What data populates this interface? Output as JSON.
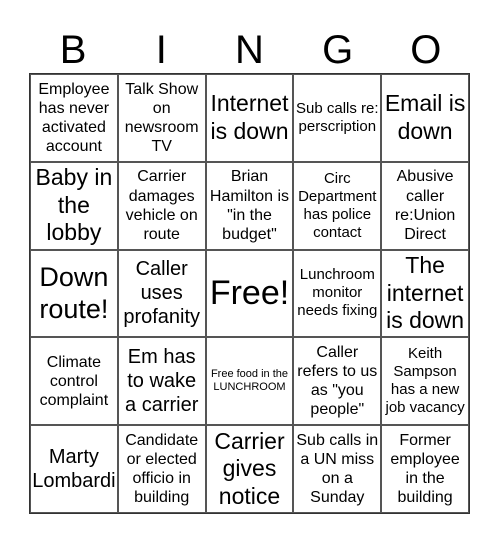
{
  "header": [
    "B",
    "I",
    "N",
    "G",
    "O"
  ],
  "cells": [
    "Employee has never activated account",
    "Talk Show on newsroom TV",
    "Internet is down",
    "Sub calls re: perscription",
    "Email is down",
    "Baby in the lobby",
    "Carrier damages vehicle on route",
    "Brian Hamilton is \"in the budget\"",
    "Circ Department has police contact",
    "Abusive caller re:Union Direct",
    "Down route!",
    "Caller uses profanity",
    "Free!",
    "Lunchroom monitor needs fixing",
    "The internet is down",
    "Climate control complaint",
    "Em has to wake a carrier",
    "Free food in the LUNCHROOM",
    "Caller refers to us as \"you people\"",
    "Keith Sampson has a new job vacancy",
    "Marty Lombardi",
    "Candidate or elected officio in building",
    "Carrier gives notice",
    "Sub calls in a UN miss on a Sunday",
    "Former employee in the building"
  ]
}
